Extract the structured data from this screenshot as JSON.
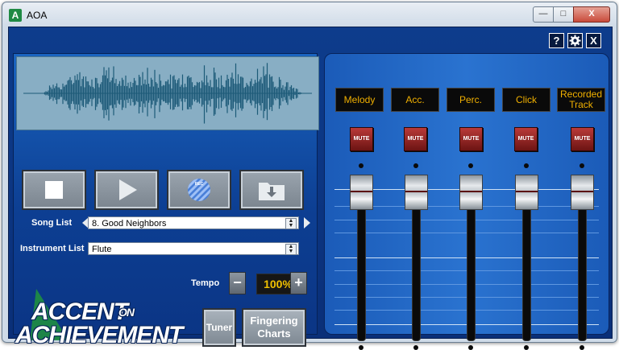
{
  "window": {
    "title": "AOA",
    "icon": "aoa-app-icon",
    "controls": {
      "minimize": "—",
      "maximize": "□",
      "close": "X"
    }
  },
  "topbar": {
    "help": "?",
    "settings_icon": "gear-icon",
    "close": "X"
  },
  "transport": {
    "stop_icon": "stop-icon",
    "play_icon": "play-icon",
    "record_icon": "record-striped-icon",
    "load_icon": "folder-download-icon"
  },
  "song": {
    "label": "Song List",
    "value": "8. Good Neighbors"
  },
  "instrument": {
    "label": "Instrument List",
    "value": "Flute"
  },
  "tempo": {
    "label": "Tempo",
    "value": "100%",
    "minus": "−",
    "plus": "+"
  },
  "buttons": {
    "tuner": "Tuner",
    "fingering": "Fingering Charts",
    "fingering_line1": "Fingering",
    "fingering_line2": "Charts"
  },
  "logo": {
    "line1": "ACCENT",
    "on": "ON",
    "line2": "ACHIEVEMENT"
  },
  "mixer": {
    "channels": [
      {
        "name": "Melody",
        "mute": "MUTE",
        "level": 0.9
      },
      {
        "name": "Acc.",
        "mute": "MUTE",
        "level": 0.9
      },
      {
        "name": "Perc.",
        "mute": "MUTE",
        "level": 0.9
      },
      {
        "name": "Click",
        "mute": "MUTE",
        "level": 0.9
      },
      {
        "name": "Recorded Track",
        "name_line1": "Recorded",
        "name_line2": "Track",
        "mute": "MUTE",
        "level": 0.9
      }
    ]
  },
  "colors": {
    "panel": "#0d3c8c",
    "accent_label": "#f0b000",
    "tempo_text": "#f0c000",
    "waveform": "#1d5a78",
    "waveform_bg": "#88aec4"
  }
}
